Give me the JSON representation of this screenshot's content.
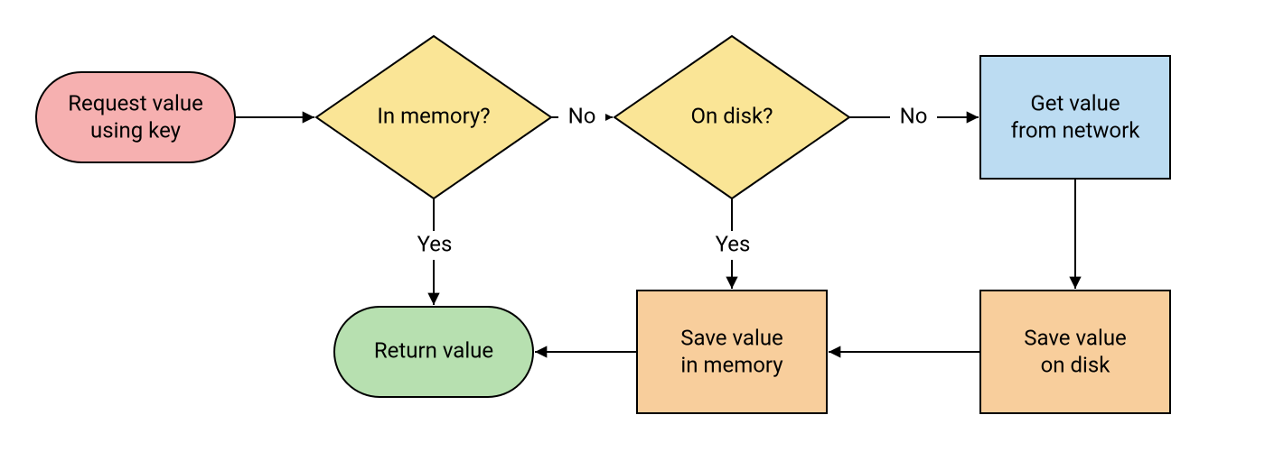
{
  "nodes": {
    "request": {
      "label1": "Request value",
      "label2": "using key"
    },
    "in_memory": {
      "label": "In memory?"
    },
    "on_disk": {
      "label": "On disk?"
    },
    "get_network": {
      "label1": "Get value",
      "label2": "from network"
    },
    "return": {
      "label": "Return value"
    },
    "save_memory": {
      "label1": "Save value",
      "label2": "in memory"
    },
    "save_disk": {
      "label1": "Save value",
      "label2": "on disk"
    }
  },
  "edges": {
    "inmem_no": "No",
    "inmem_yes": "Yes",
    "ondisk_no": "No",
    "ondisk_yes": "Yes"
  },
  "colors": {
    "start": "#f6b0b0",
    "decision": "#fae596",
    "process_blue": "#bcdcf2",
    "process_orange": "#f8ce9c",
    "end": "#b7e0b0"
  }
}
